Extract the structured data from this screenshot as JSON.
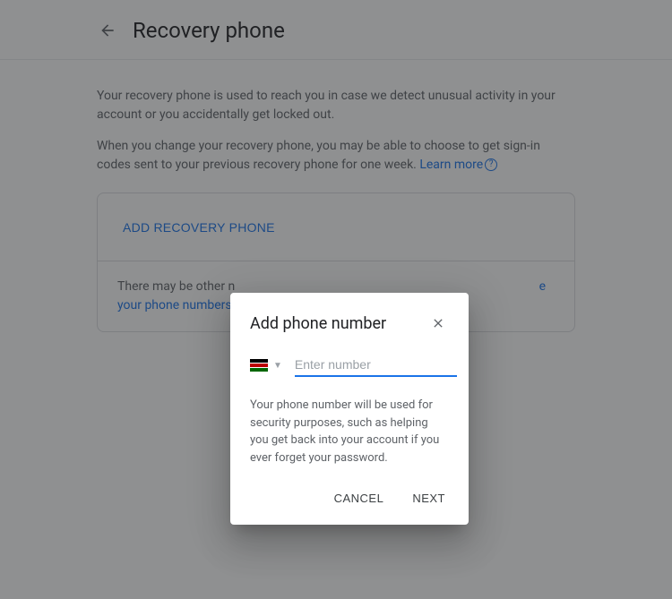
{
  "header": {
    "title": "Recovery phone"
  },
  "content": {
    "desc1": "Your recovery phone is used to reach you in case we detect unusual activity in your account or you accidentally get locked out.",
    "desc2_prefix": "When you change your recovery phone, you may be able to choose to get sign-in codes sent to your previous recovery phone for one week. ",
    "learn_more": "Learn more",
    "add_button": "ADD RECOVERY PHONE",
    "card_note_prefix": "There may be other n",
    "card_note_suffix": "e your phone numbers"
  },
  "dialog": {
    "title": "Add phone number",
    "placeholder": "Enter number",
    "desc": "Your phone number will be used for security purposes, such as helping you get back into your account if you ever forget your password.",
    "cancel": "CANCEL",
    "next": "NEXT"
  }
}
